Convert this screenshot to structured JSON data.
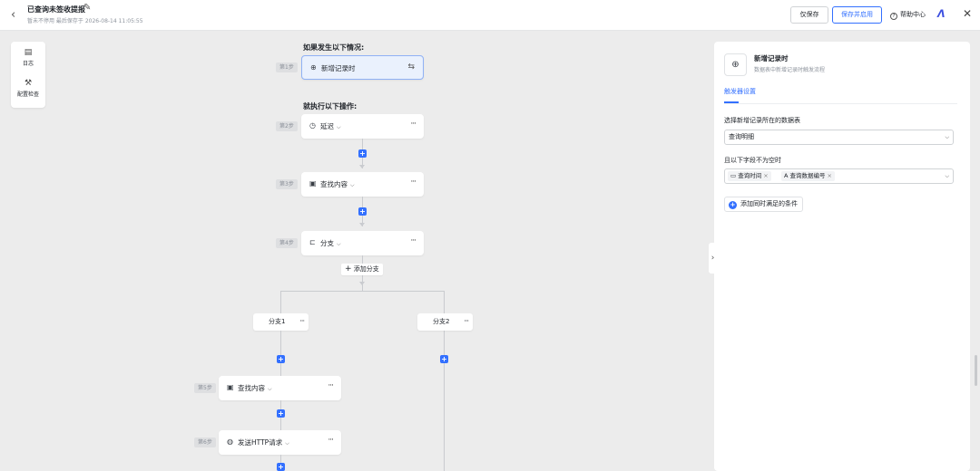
{
  "header": {
    "title": "已查询未签收提报",
    "subtitle": "暂未不停用 最后保存于 2026-08-14 11:05:55",
    "back_icon": "‹",
    "draft_label": "仅保存",
    "save_enable_label": "保存并启用",
    "help_label": "帮助中心",
    "help_icon_char": "?",
    "close_icon": "✕"
  },
  "toolbar": {
    "log_label": "日志",
    "config_check_label": "配置检查"
  },
  "canvas": {
    "if_label": "如果发生以下情况:",
    "then_label": "就执行以下操作:",
    "add_branch_label": "添加分支",
    "steps": [
      {
        "tag": "第1步",
        "label": "新增记录时",
        "icon": "⊕"
      },
      {
        "tag": "第2步",
        "label": "延迟",
        "icon": "◷"
      },
      {
        "tag": "第3步",
        "label": "查找内容",
        "icon": "▣"
      },
      {
        "tag": "第4步",
        "label": "分支",
        "icon": "⊏"
      },
      {
        "tag": "第5步",
        "label": "查找内容",
        "icon": "▣"
      },
      {
        "tag": "第6步",
        "label": "发送HTTP请求",
        "icon": "◍"
      }
    ],
    "branches": [
      {
        "label": "分支1"
      },
      {
        "label": "分支2"
      }
    ]
  },
  "panel": {
    "title": "新增记录时",
    "description": "数据表中新增记录时触发流程",
    "tab_label": "触发器设置",
    "table_label": "选择新增记录所在的数据表",
    "table_value": "查询明细",
    "fields_label": "且以下字段不为空时",
    "fields": [
      {
        "label": "查询时间",
        "icon": "▭"
      },
      {
        "label": "查询数据编号",
        "icon": "A"
      }
    ],
    "add_condition_label": "添加同时满足的条件"
  },
  "colors": {
    "accent": "#3370ff",
    "canvas_bg": "#ececec",
    "trigger_bg": "#eaf1fd"
  }
}
